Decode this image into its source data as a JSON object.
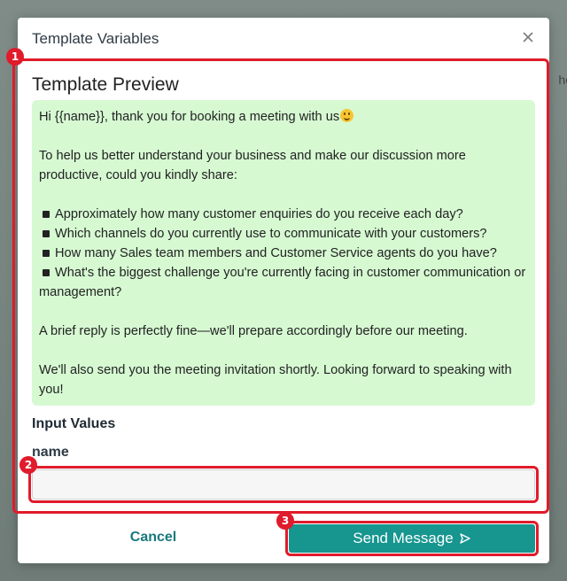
{
  "background": {
    "partial_text": "he"
  },
  "modal": {
    "title": "Template Variables",
    "close_icon": "close-icon"
  },
  "annotations": {
    "badge1": "1",
    "badge2": "2",
    "badge3": "3",
    "color": "#e01b2b"
  },
  "preview": {
    "title": "Template Preview",
    "greeting": "Hi {{name}}, thank you for booking a meeting with us",
    "intro": "To help us better understand your business and make our discussion more productive, could you kindly share:",
    "questions": [
      "Approximately how many customer enquiries do you receive each day?",
      "Which channels do you currently use to communicate with your customers?",
      "How many Sales team members and Customer Service agents do you have?",
      "What's the biggest challenge you're currently facing in customer communication or management?"
    ],
    "reply_note": "A brief reply is perfectly fine—we'll prepare accordingly before our meeting.",
    "closing": "We'll also send you the meeting invitation shortly. Looking forward to speaking with you!",
    "background_color": "#d6f9d2"
  },
  "inputs": {
    "section_title": "Input Values",
    "fields": [
      {
        "label": "name",
        "value": "",
        "placeholder": ""
      }
    ]
  },
  "footer": {
    "cancel_label": "Cancel",
    "send_label": "Send Message",
    "send_icon": "send-icon",
    "accent": "#17958f"
  }
}
